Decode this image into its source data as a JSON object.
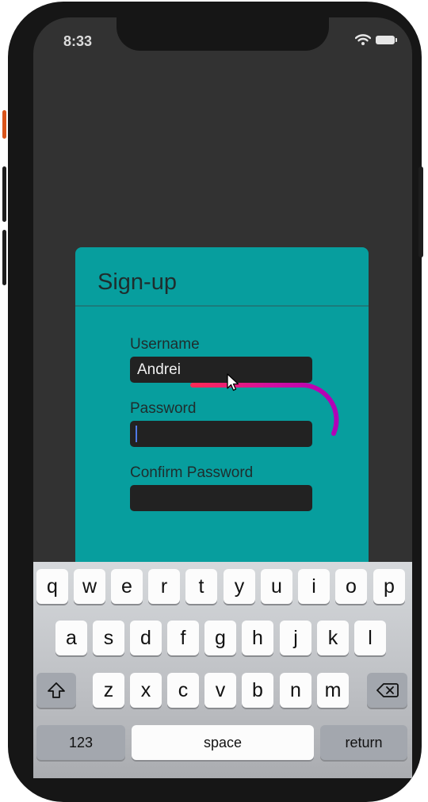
{
  "status_bar": {
    "time": "8:33"
  },
  "signup": {
    "title": "Sign-up",
    "username_label": "Username",
    "username_value": "Andrei",
    "password_label": "Password",
    "password_value": "",
    "confirm_label": "Confirm Password",
    "confirm_value": ""
  },
  "keyboard": {
    "row1": [
      "q",
      "w",
      "e",
      "r",
      "t",
      "y",
      "u",
      "i",
      "o",
      "p"
    ],
    "row2": [
      "a",
      "s",
      "d",
      "f",
      "g",
      "h",
      "j",
      "k",
      "l"
    ],
    "row3": [
      "z",
      "x",
      "c",
      "v",
      "b",
      "n",
      "m"
    ],
    "numbers_label": "123",
    "space_label": "space",
    "return_label": "return"
  },
  "colors": {
    "card": "#079e9e",
    "input_bg": "#222222",
    "screen_bg": "#323232",
    "gesture_trail": "#cc00aa"
  },
  "icons": {
    "shift": "shift-icon",
    "backspace": "backspace-icon",
    "wifi": "wifi-icon",
    "battery": "battery-icon",
    "pointer": "mouse-pointer-icon"
  }
}
